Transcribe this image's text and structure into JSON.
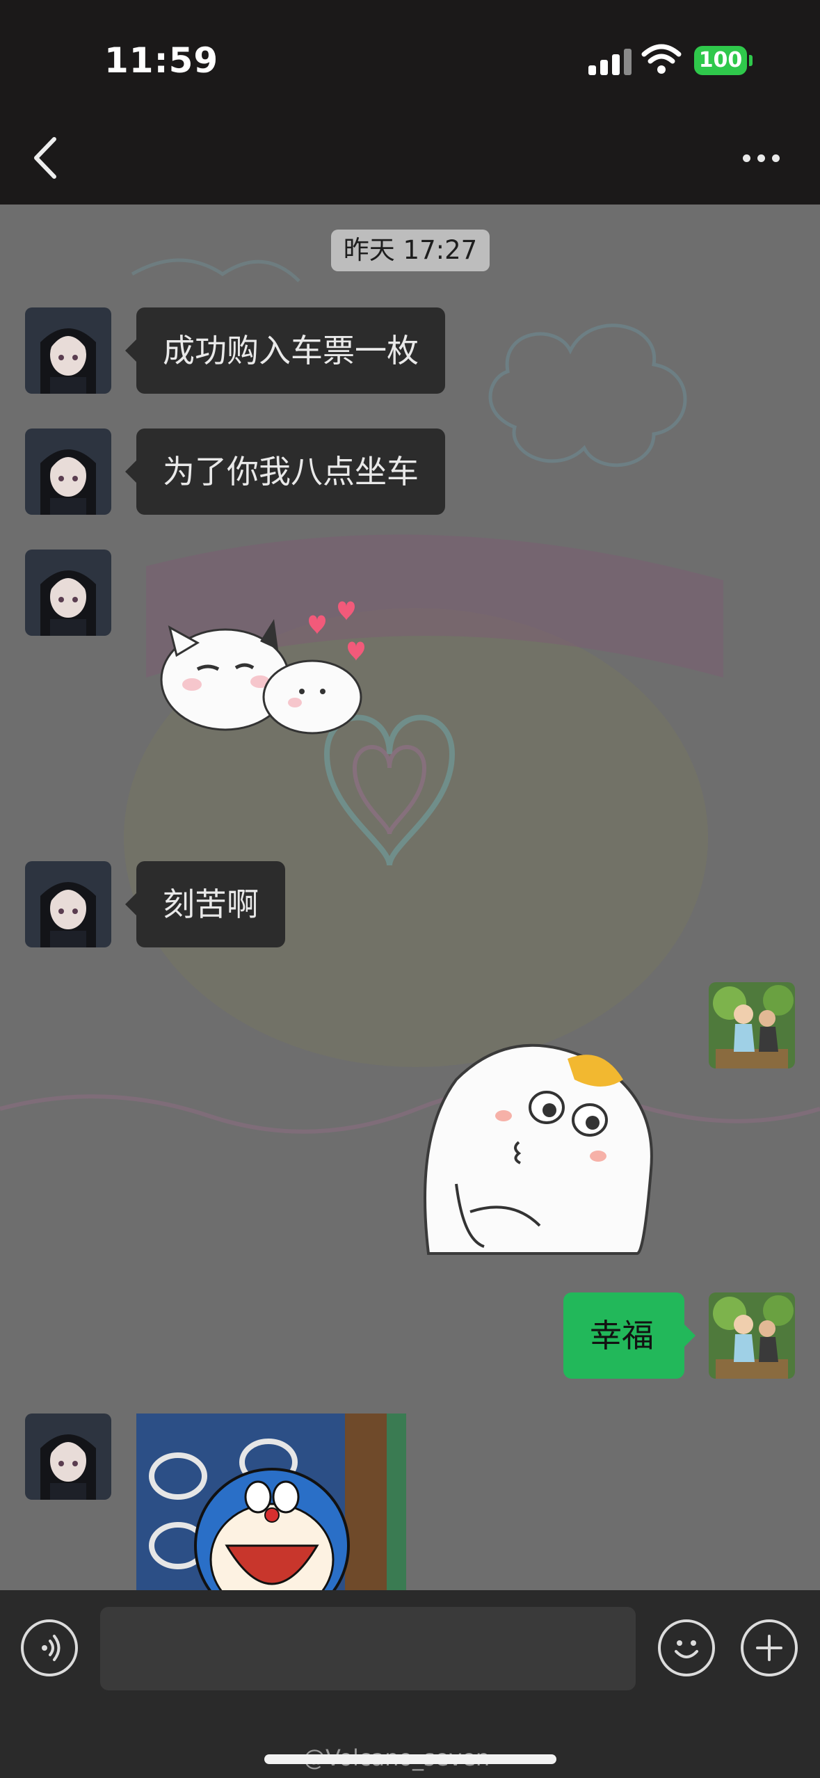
{
  "status_bar": {
    "time": "11:59",
    "battery": "100",
    "signal_icon": "cellular-signal-icon",
    "wifi_icon": "wifi-icon"
  },
  "nav": {
    "back_icon": "chevron-left-icon",
    "more_icon": "ellipsis-icon"
  },
  "chat": {
    "timestamp": "昨天 17:27",
    "messages": [
      {
        "sender": "contact",
        "type": "text",
        "text": "成功购入车票一枚"
      },
      {
        "sender": "contact",
        "type": "text",
        "text": "为了你我八点坐车"
      },
      {
        "sender": "contact",
        "type": "sticker",
        "sticker": "cats-hugging-hearts-sticker"
      },
      {
        "sender": "contact",
        "type": "text",
        "text": "刻苦啊"
      },
      {
        "sender": "me",
        "type": "sticker",
        "sticker": "cat-kissing-face-sticker"
      },
      {
        "sender": "me",
        "type": "text",
        "text": "幸福"
      },
      {
        "sender": "contact",
        "type": "image",
        "image": "doraemon-laughing-image"
      }
    ]
  },
  "input_bar": {
    "voice_icon": "voice-icon",
    "emoji_icon": "emoji-icon",
    "plus_icon": "plus-icon",
    "message_value": ""
  },
  "watermark": "@Volcano_seven",
  "colors": {
    "header_bg": "#1b1919",
    "chat_bg": "#6e6e6e",
    "incoming_bubble": "#2c2c2c",
    "outgoing_bubble": "#22b85a",
    "battery_green": "#2fc84b"
  }
}
